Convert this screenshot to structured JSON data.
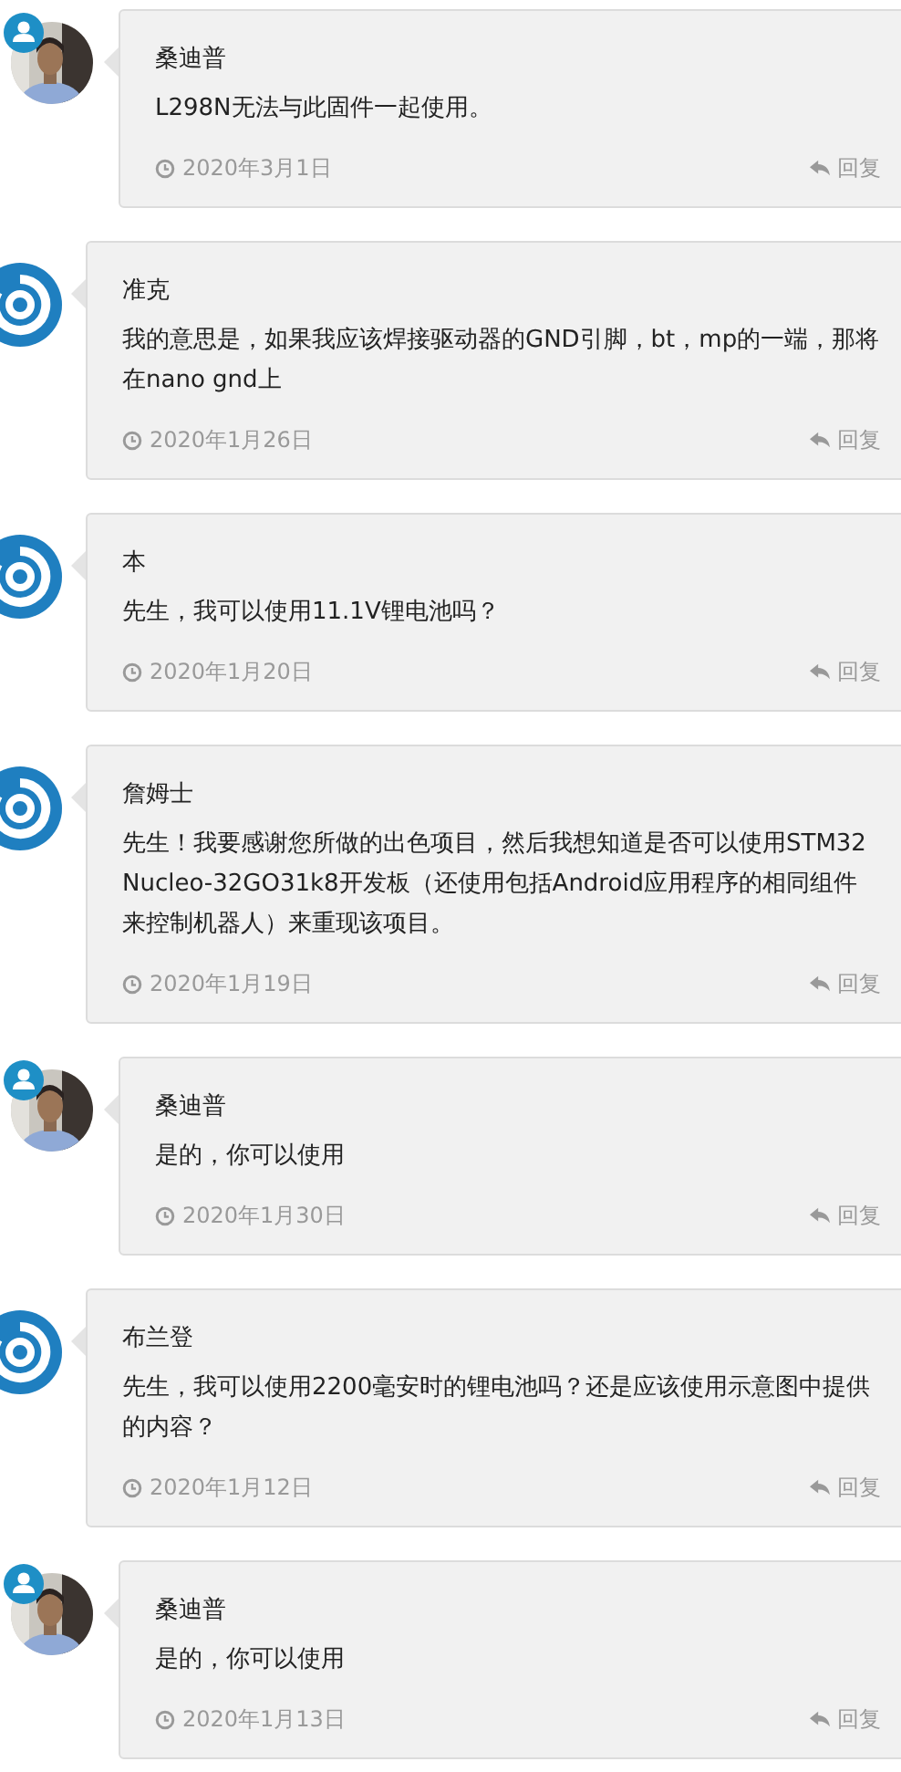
{
  "comments": [
    {
      "kind": "author",
      "name": "桑迪普",
      "text": "L298N无法与此固件一起使用。",
      "date": "2020年3月1日",
      "reply": "回复"
    },
    {
      "kind": "guest",
      "name": "准克",
      "text": "我的意思是，如果我应该焊接驱动器的GND引脚，bt，mp的一端，那将在nano gnd上",
      "date": "2020年1月26日",
      "reply": "回复"
    },
    {
      "kind": "guest",
      "name": "本",
      "text": "先生，我可以使用11.1V锂电池吗？",
      "date": "2020年1月20日",
      "reply": "回复"
    },
    {
      "kind": "guest",
      "name": "詹姆士",
      "text": "先生！我要感谢您所做的出色项目，然后我想知道是否可以使用STM32 Nucleo-32GO31k8开发板（还使用包括Android应用程序的相同组件来控制机器人）来重现该项目。",
      "date": "2020年1月19日",
      "reply": "回复"
    },
    {
      "kind": "author",
      "name": "桑迪普",
      "text": "是的，你可以使用",
      "date": "2020年1月30日",
      "reply": "回复"
    },
    {
      "kind": "guest",
      "name": "布兰登",
      "text": "先生，我可以使用2200毫安时的锂电池吗？还是应该使用示意图中提供的内容？",
      "date": "2020年1月12日",
      "reply": "回复"
    },
    {
      "kind": "author",
      "name": "桑迪普",
      "text": "是的，你可以使用",
      "date": "2020年1月13日",
      "reply": "回复"
    }
  ]
}
